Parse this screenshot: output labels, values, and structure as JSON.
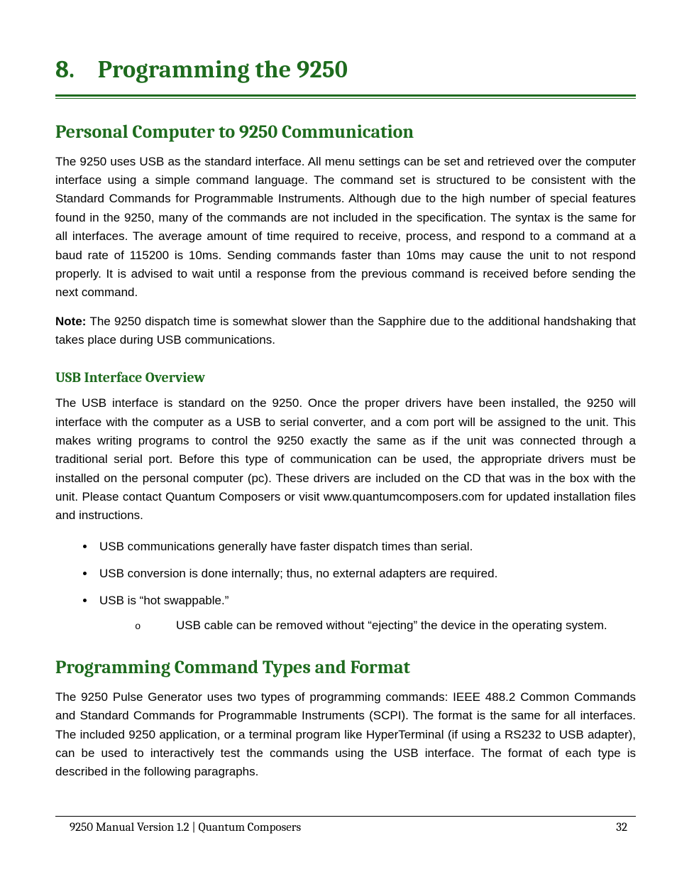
{
  "heading1": {
    "number": "8.",
    "text": "Programming the 9250"
  },
  "section1": {
    "title": "Personal Computer to 9250 Communication",
    "p1": "The 9250 uses USB as the standard interface. All menu settings can be set and retrieved over the computer interface using a simple command language. The command set is structured to be consistent with the Standard Commands for Programmable Instruments. Although due to the high number of special features found in the 9250, many of the commands are not included in the specification. The syntax is the same for all interfaces. The average amount of time required to receive, process, and respond to a command at a baud rate of 115200 is 10ms. Sending commands faster than 10ms may cause the unit to not respond properly. It is advised to wait until a response from the previous command is received before sending the next command.",
    "noteLabel": "Note:",
    "note": "The 9250 dispatch time is somewhat slower than the Sapphire due to the additional handshaking that takes place during USB communications."
  },
  "usb": {
    "title": "USB Interface Overview",
    "p1": "The USB interface is standard on the 9250. Once the proper drivers have been installed, the 9250 will interface with the computer as a USB to serial converter, and a com port will be assigned to the unit. This makes writing programs to control the 9250 exactly the same as if the unit was connected through a traditional serial port. Before this type of communication can be used, the appropriate drivers must be installed on the personal computer (pc). These drivers are included on the CD that was in the box with the unit. Please contact Quantum Composers or visit www.quantumcomposers.com for updated installation files and instructions.",
    "bullets": [
      "USB communications generally have faster dispatch times than serial.",
      "USB conversion is done internally; thus, no external adapters are required.",
      "USB is “hot swappable.”",
      "USB cable can be removed without “ejecting” the device in the operating system."
    ]
  },
  "section2": {
    "title": "Programming Command Types and Format",
    "p1": "The 9250 Pulse Generator uses two types of programming commands: IEEE 488.2 Common Commands and Standard Commands for Programmable Instruments (SCPI). The format is the same for all interfaces. The included 9250 application, or a terminal program like HyperTerminal (if using a RS232 to USB adapter), can be used to interactively test the commands using the USB interface. The format of each type is described in the following paragraphs."
  },
  "footer": {
    "left": "9250 Manual Version 1.2  |  Quantum Composers",
    "page": "32"
  }
}
